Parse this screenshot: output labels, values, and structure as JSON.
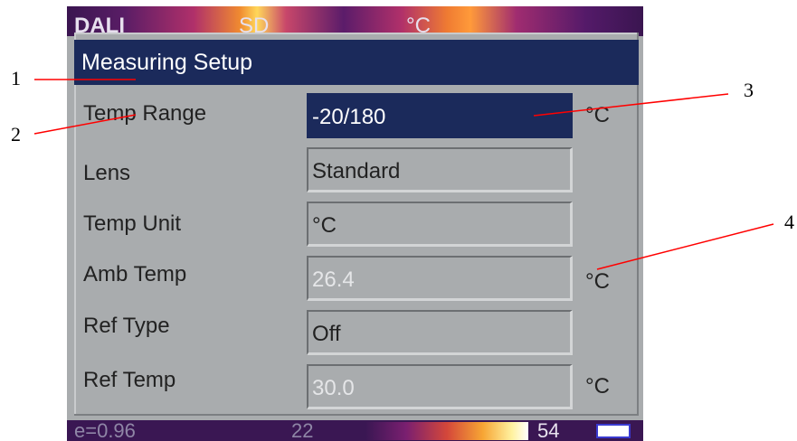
{
  "top_bar": {
    "left_text": "DALI",
    "middle_text": "SD",
    "right_text": "°C"
  },
  "dialog": {
    "title": "Measuring Setup",
    "rows": [
      {
        "label": "Temp Range",
        "value": "-20/180",
        "unit": "°C",
        "state": "selected"
      },
      {
        "label": "Lens",
        "value": "Standard",
        "unit": "",
        "state": "normal"
      },
      {
        "label": "Temp Unit",
        "value": "°C",
        "unit": "",
        "state": "normal"
      },
      {
        "label": "Amb Temp",
        "value": "26.4",
        "unit": "°C",
        "state": "dim"
      },
      {
        "label": "Ref Type",
        "value": "Off",
        "unit": "",
        "state": "normal"
      },
      {
        "label": "Ref Temp",
        "value": "30.0",
        "unit": "°C",
        "state": "dim"
      }
    ]
  },
  "bottom_bar": {
    "emissivity": "e=0.96",
    "min_temp": "22",
    "max_temp": "54"
  },
  "callouts": [
    "1",
    "2",
    "3",
    "4"
  ],
  "colors": {
    "title_bar": "#1b2a5b",
    "panel_bg": "#a9acae",
    "annotation_line": "#ff0000"
  }
}
